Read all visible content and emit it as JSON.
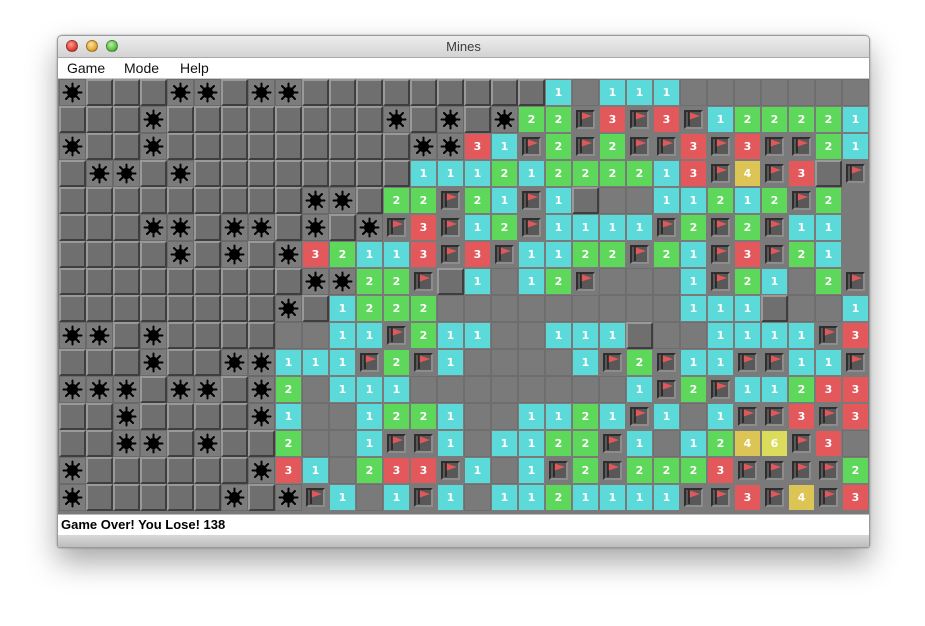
{
  "window": {
    "title": "Mines"
  },
  "menu": {
    "items": [
      "Game",
      "Mode",
      "Help"
    ]
  },
  "status": {
    "text": "Game Over! You Lose! 138"
  },
  "colors": {
    "n1": "#5cdada",
    "n2": "#5ed85a",
    "n3": "#e2585b",
    "n4": "#dcc455",
    "n6": "#dcdc5c",
    "flag": "#e0585a",
    "covered": "#6f6f6f",
    "board": "#7a7a7a"
  },
  "legend": {
    "#": "covered",
    "*": "mine",
    "F": "flag",
    ".": "revealed-empty",
    "1-8": "adjacent mine count"
  },
  "board": {
    "cols": 30,
    "rows": 16,
    "grid": [
      "*##|**#**#########1.111.......",
      "###*########*#*#*22F3F3F1222211",
      "*##*#########**31F2F2FF3F3FF21",
      "#**#*########11121222213F4F3#F",
      "#########**#22F21F1#..11212F2",
      "###**#**#*#*F3F12F1111F2F2F11",
      "####*#*#*32113F3F1122F21F3F21",
      "#########**22F#1.12F...1F21.2F2F",
      "########*#1222.........111#..1F1F",
      "**#*####..11F211..111#..1111F33",
      "###*##**111F2F1....1F2F11FF11FF",
      "***#**#*2.111........1F2F11233F4F",
      "##*####*1..1221..1121F1.1FF3F31",
      "##**#*##2..1FF1.1122F1.1246F3.",
      "*######*31.233F1.1F2F2223FFFF2.",
      "*#####*#*F1.1F1.1121111FF3F4F31."
    ]
  }
}
